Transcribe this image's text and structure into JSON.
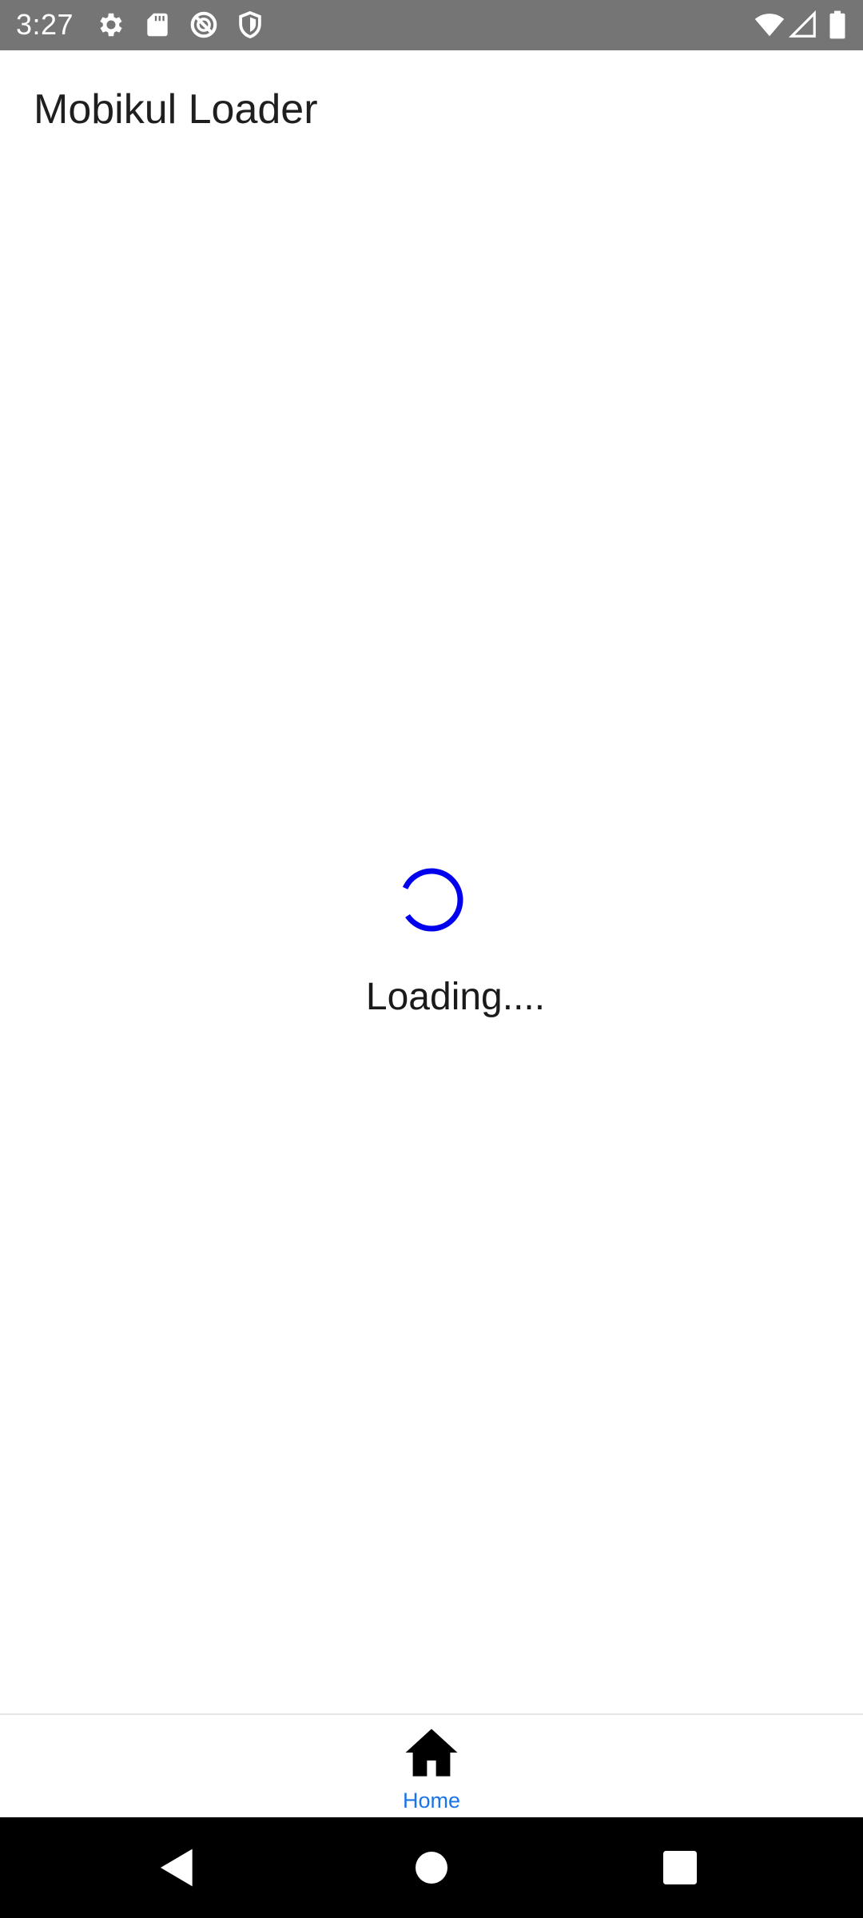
{
  "status_bar": {
    "time": "3:27",
    "left_icons": [
      "settings-icon",
      "sd-card-icon",
      "do-not-disturb-icon",
      "shield-icon"
    ],
    "right_icons": [
      "wifi-icon",
      "cellular-signal-icon",
      "battery-icon"
    ]
  },
  "app_bar": {
    "title": "Mobikul Loader"
  },
  "loader": {
    "text": "Loading....",
    "spinner_color": "#0000ee"
  },
  "bottom_nav": {
    "items": [
      {
        "label": "Home",
        "icon": "home-icon",
        "active": true
      }
    ],
    "active_color": "#1a73e8"
  },
  "system_nav": {
    "buttons": [
      "back-icon",
      "home-circle-icon",
      "recents-icon"
    ]
  }
}
